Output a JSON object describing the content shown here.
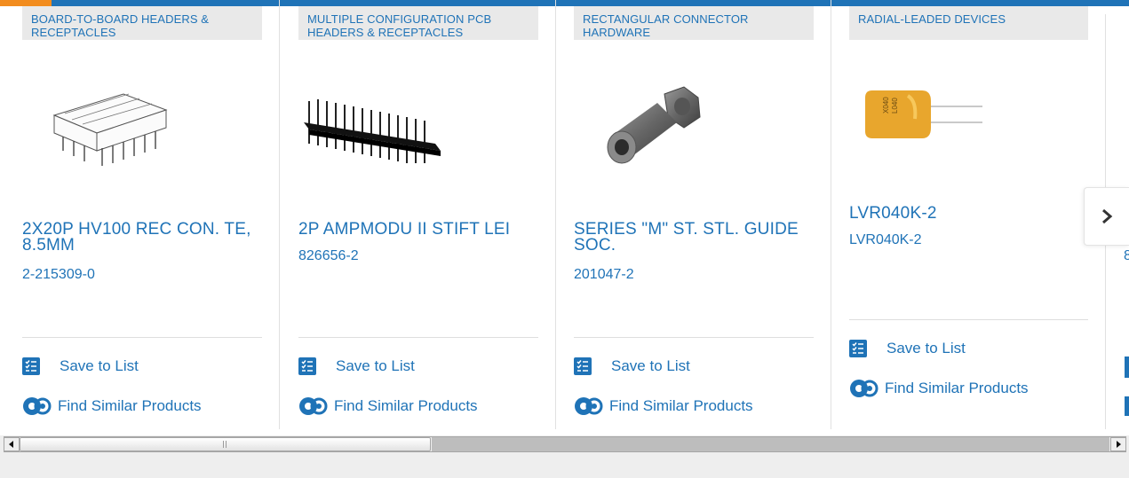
{
  "cards": [
    {
      "category": "BOARD-TO-BOARD HEADERS & RECEPTACLES",
      "title": "2X20P HV100 REC CON. TE, 8.5MM",
      "part": "2-215309-0",
      "image_icon": "dual-row-receptacle-image"
    },
    {
      "category": "MULTIPLE CONFIGURATION PCB HEADERS & RECEPTACLES",
      "title": "2P AMPMODU II STIFT LEI",
      "part": "826656-2",
      "image_icon": "pin-header-image"
    },
    {
      "category": "RECTANGULAR CONNECTOR HARDWARE",
      "title": "SERIES \"M\" ST. STL. GUIDE SOC.",
      "part": "201047-2",
      "image_icon": "guide-socket-image"
    },
    {
      "category": "RADIAL-LEADED DEVICES",
      "title": "LVR040K-2",
      "part": "LVR040K-2",
      "image_icon": "radial-ptc-fuse-image",
      "component_marking": "X040 L040"
    }
  ],
  "actions": {
    "save_to_list": "Save to List",
    "find_similar": "Find Similar Products"
  },
  "peek": {
    "digit": "8"
  },
  "icons": [
    "save-list-icon",
    "find-similar-gears-icon",
    "chevron-right-icon",
    "scroll-left-arrow-icon",
    "scroll-right-arrow-icon"
  ],
  "colors": {
    "link": "#1f73b7",
    "top_bar": "#1f73b7",
    "top_bar_accent": "#f28c1e",
    "category_bg": "#e9e9e9",
    "fuse": "#e8a62d"
  }
}
